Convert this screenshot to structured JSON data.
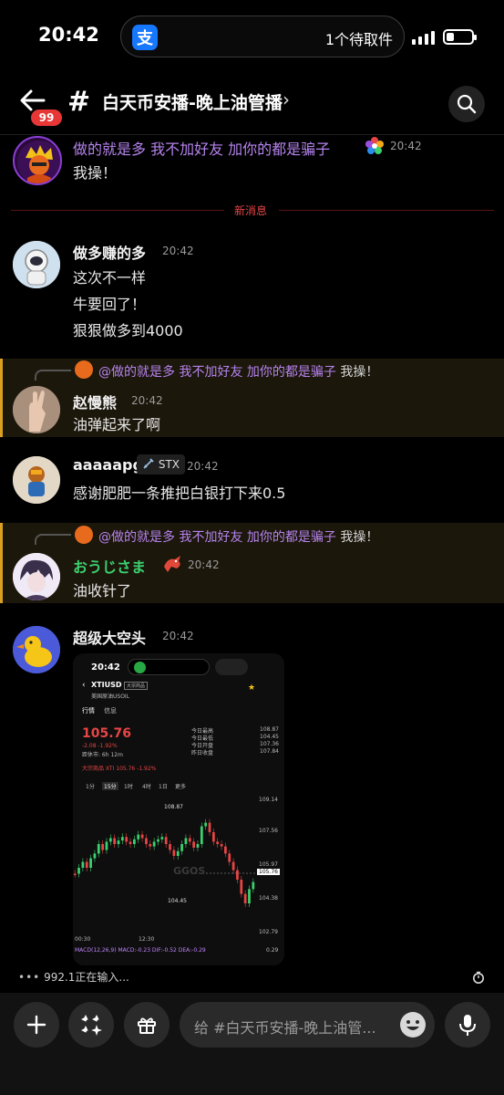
{
  "status_bar": {
    "time": "20:42",
    "island_app": "支",
    "island_text": "1个待取件"
  },
  "header": {
    "badge": "99",
    "hash": "#",
    "title": "白天币安播-晚上油管播",
    "chevron": "›"
  },
  "messages": [
    {
      "author": "做的就是多 我不加好友 加你的都是骗子",
      "time": "20:42",
      "lines": [
        "我操！"
      ]
    },
    {
      "author": "做多赚的多",
      "time": "20:42",
      "lines": [
        "这次不一样",
        "牛要回了！",
        "狠狠做多到4000"
      ]
    },
    {
      "author": "赵慢熊",
      "time": "20:42",
      "reply": {
        "to": "@做的就是多 我不加好友 加你的都是骗子",
        "text": "我操！"
      },
      "lines": [
        "油弹起来了啊"
      ]
    },
    {
      "author": "aaaaapg",
      "tag": "STX",
      "time": "20:42",
      "lines": [
        "感谢肥肥一条推把白银打下来0.5"
      ]
    },
    {
      "author": "おうじさま",
      "time": "20:42",
      "reply": {
        "to": "@做的就是多 我不加好友 加你的都是骗子",
        "text": "我操！"
      },
      "lines": [
        "油收针了"
      ]
    },
    {
      "author": "超级大空头",
      "time": "20:42",
      "lines": []
    }
  ],
  "new_messages_label": "新消息",
  "screenshot": {
    "time": "20:42",
    "symbol": "XTIUSD",
    "symbol_tag": "大宗商品",
    "subtitle": "美国原油USOIL",
    "tabs": [
      "行情",
      "信息"
    ],
    "price": "105.76",
    "change": "-2.08 -1.92%",
    "close_note": "距休市: 6h 12m",
    "stats": [
      {
        "label": "今日最高",
        "value": "108.87"
      },
      {
        "label": "今日最低",
        "value": "104.45"
      },
      {
        "label": "今日开盘",
        "value": "107.36"
      },
      {
        "label": "昨日收盘",
        "value": "107.84"
      }
    ],
    "commodity_line": "大宗商品 XTI 105.76 -1.92%",
    "intervals": [
      "1分",
      "15分",
      "1时",
      "4时",
      "1日",
      "更多"
    ],
    "axis_labels": [
      "109.14",
      "107.56",
      "105.97",
      "104.38",
      "102.79"
    ],
    "high_label": "108.87",
    "low_label": "104.45",
    "last_label": "105.76",
    "time_labels": [
      "00:30",
      "12:30"
    ],
    "macd": "MACD(12,26,9)  MACD:-0.23  DIF:-0.52  DEA:-0.29",
    "macd_axis": "0.29",
    "watermark": "GGOS"
  },
  "typing": {
    "dots": "•••",
    "text": "992.1正在输入..."
  },
  "input": {
    "placeholder": "给 #白天币安播-晚上油管..."
  },
  "colors": {
    "accent_red": "#e63636",
    "mention": "#b583ee",
    "highlight_bar": "#d9a021",
    "green_name": "#3bd16f"
  }
}
